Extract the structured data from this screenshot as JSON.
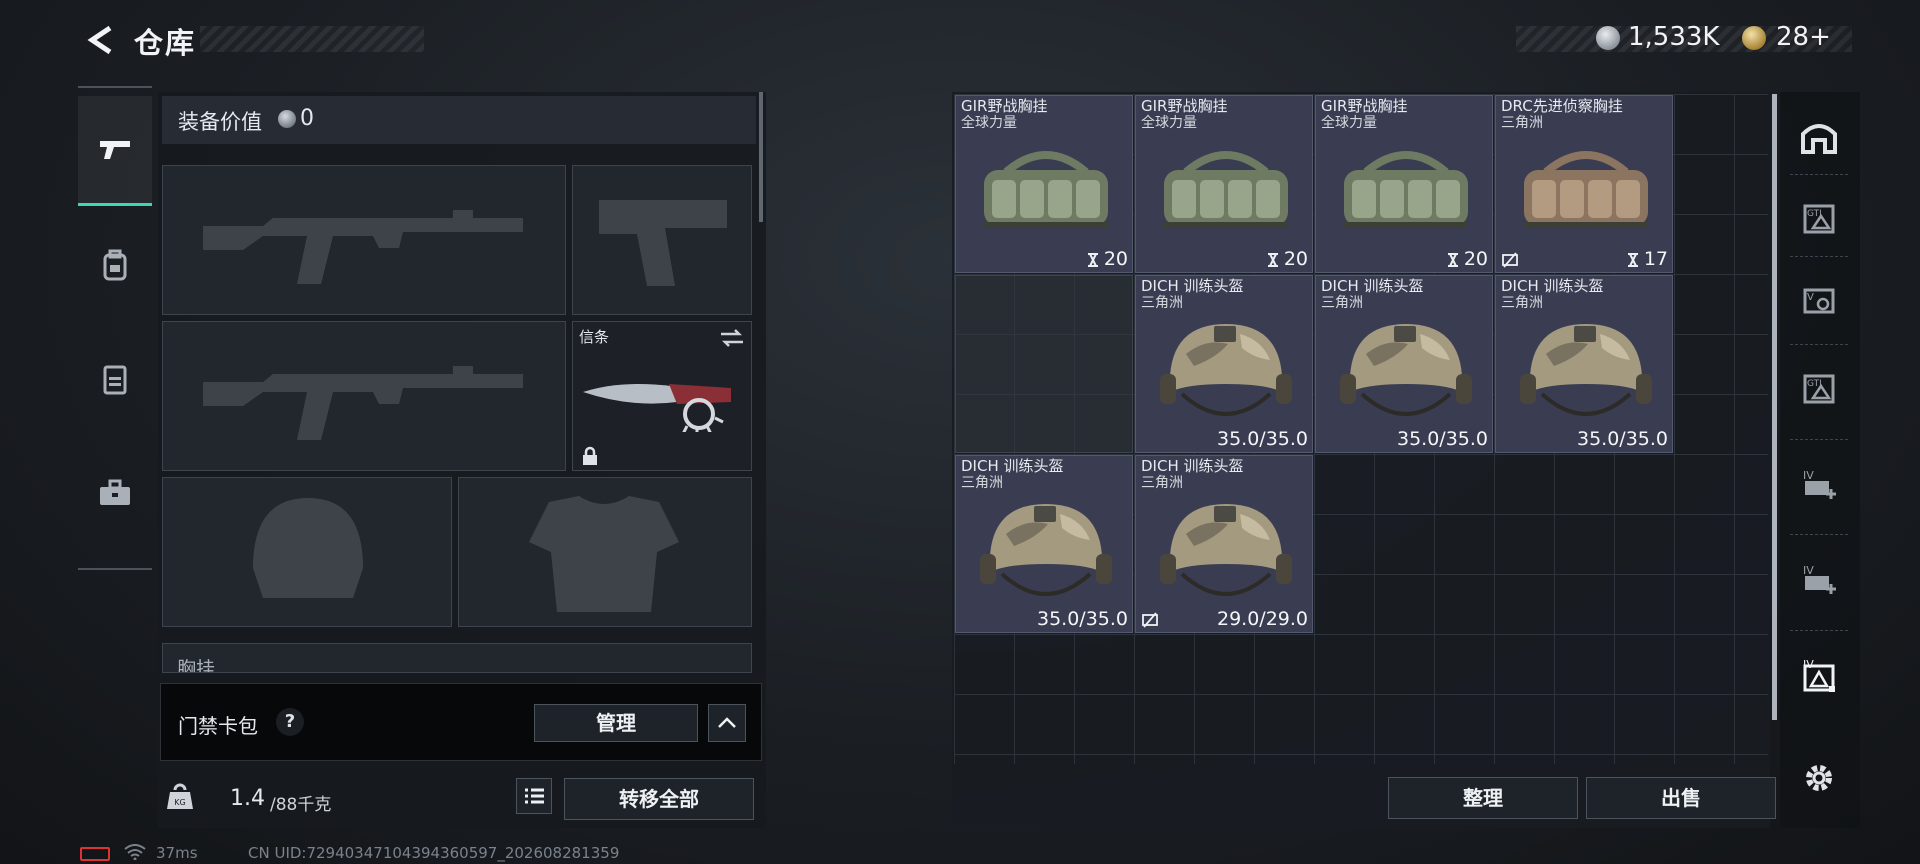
{
  "header": {
    "title": "仓库",
    "currency_1": "1,533K",
    "currency_2": "28+"
  },
  "left_rail": [
    "gun-icon",
    "backpack-icon",
    "vest-icon",
    "briefcase-icon"
  ],
  "loadout": {
    "equip_value_label": "装备价值",
    "equip_value": "0",
    "knife_slot_label": "信条",
    "chest_rig_label": "胸挂"
  },
  "card_pack": {
    "label": "门禁卡包",
    "help": "?",
    "manage": "管理"
  },
  "capacity": {
    "current": "1.4",
    "max": "/88千克",
    "transfer_all": "转移全部"
  },
  "footer": {
    "ping": "37ms",
    "uid": "CN UID:72940347104394360597_202608281359"
  },
  "storage_items": [
    {
      "name": "GIR野战胸挂",
      "sub": "全球力量",
      "value": "20",
      "type": "rig",
      "color": "green"
    },
    {
      "name": "GIR野战胸挂",
      "sub": "全球力量",
      "value": "20",
      "type": "rig",
      "color": "green"
    },
    {
      "name": "GIR野战胸挂",
      "sub": "全球力量",
      "value": "20",
      "type": "rig",
      "color": "green"
    },
    {
      "name": "DRC先进侦察胸挂",
      "sub": "三角洲",
      "value": "17",
      "type": "rig",
      "color": "tan"
    },
    {
      "name": "DICH 训练头盔",
      "sub": "三角洲",
      "value": "35.0/35.0",
      "type": "helmet"
    },
    {
      "name": "DICH 训练头盔",
      "sub": "三角洲",
      "value": "35.0/35.0",
      "type": "helmet"
    },
    {
      "name": "DICH 训练头盔",
      "sub": "三角洲",
      "value": "35.0/35.0",
      "type": "helmet"
    },
    {
      "name": "DICH 训练头盔",
      "sub": "三角洲",
      "value": "35.0/35.0",
      "type": "helmet"
    },
    {
      "name": "DICH 训练头盔",
      "sub": "三角洲",
      "value": "29.0/29.0",
      "type": "helmet"
    }
  ],
  "actions": {
    "sort": "整理",
    "sell": "出售"
  },
  "right_rail": [
    "shelter-icon",
    "gti-tag-icon",
    "v-tag-icon",
    "gti-tag-icon",
    "iv-plus-icon",
    "iv-plus-icon",
    "iv-tag-icon",
    "gear-icon"
  ]
}
